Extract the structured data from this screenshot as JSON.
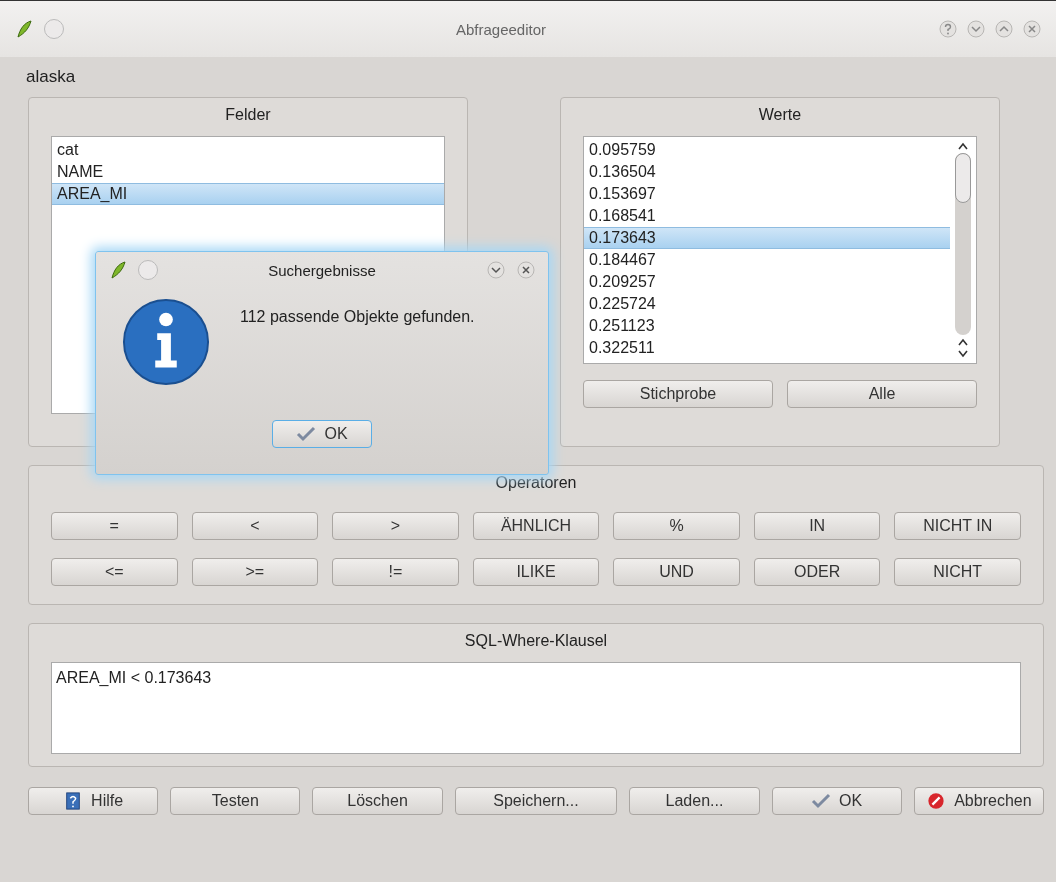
{
  "window": {
    "title": "Abfrageeditor"
  },
  "layer_name": "alaska",
  "fields": {
    "title": "Felder",
    "items": [
      {
        "label": "cat",
        "selected": false
      },
      {
        "label": "NAME",
        "selected": false
      },
      {
        "label": "AREA_MI",
        "selected": true
      }
    ]
  },
  "values": {
    "title": "Werte",
    "items": [
      {
        "label": "0.095759",
        "selected": false
      },
      {
        "label": "0.136504",
        "selected": false
      },
      {
        "label": "0.153697",
        "selected": false
      },
      {
        "label": "0.168541",
        "selected": false
      },
      {
        "label": "0.173643",
        "selected": true
      },
      {
        "label": "0.184467",
        "selected": false
      },
      {
        "label": "0.209257",
        "selected": false
      },
      {
        "label": "0.225724",
        "selected": false
      },
      {
        "label": "0.251123",
        "selected": false
      },
      {
        "label": "0.322511",
        "selected": false
      }
    ],
    "buttons": [
      "Stichprobe",
      "Alle"
    ]
  },
  "operators": {
    "title": "Operatoren",
    "rows": [
      [
        "=",
        "<",
        ">",
        "ÄHNLICH",
        "%",
        "IN",
        "NICHT IN"
      ],
      [
        "<=",
        ">=",
        "!=",
        "ILIKE",
        "UND",
        "ODER",
        "NICHT"
      ]
    ]
  },
  "sql": {
    "title": "SQL-Where-Klausel",
    "value": "AREA_MI < 0.173643"
  },
  "buttons": [
    {
      "label": "Hilfe",
      "kind": "help"
    },
    {
      "label": "Testen",
      "kind": "plain"
    },
    {
      "label": "Löschen",
      "kind": "plain"
    },
    {
      "label": "Speichern...",
      "kind": "plain"
    },
    {
      "label": "Laden...",
      "kind": "plain"
    },
    {
      "label": "OK",
      "kind": "ok"
    },
    {
      "label": "Abbrechen",
      "kind": "cancel"
    }
  ],
  "dialog": {
    "title": "Suchergebnisse",
    "message": "112 passende Objekte gefunden.",
    "button": "OK"
  }
}
